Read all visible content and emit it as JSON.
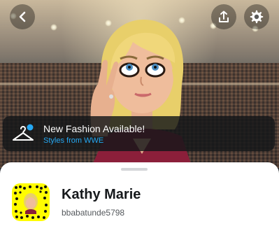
{
  "header": {
    "back_icon": "chevron-left-icon",
    "share_icon": "share-icon",
    "settings_icon": "gear-icon"
  },
  "banner": {
    "title": "New Fashion Available!",
    "subtitle": "Styles from WWE",
    "icon": "hanger-icon",
    "subtitle_color": "#25a8f3"
  },
  "profile": {
    "display_name": "Kathy Marie",
    "username": "bbabatunde5798",
    "snapcode_color": "#fffc00"
  }
}
